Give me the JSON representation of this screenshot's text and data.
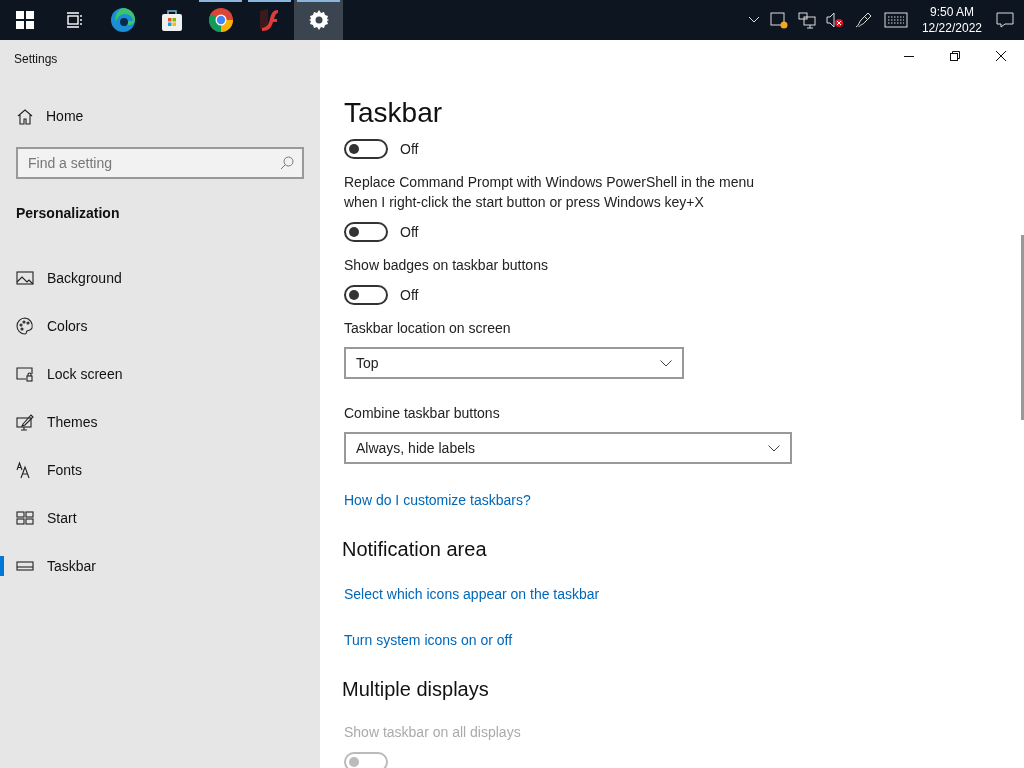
{
  "taskbar": {
    "apps": [
      {
        "kind": "start",
        "running": false,
        "selected": false
      },
      {
        "kind": "taskview",
        "running": false,
        "selected": false
      },
      {
        "kind": "edge",
        "running": false,
        "selected": false
      },
      {
        "kind": "store",
        "running": false,
        "selected": false
      },
      {
        "kind": "chrome",
        "running": true,
        "selected": false
      },
      {
        "kind": "flash",
        "running": true,
        "selected": false
      },
      {
        "kind": "settings",
        "running": true,
        "selected": true
      }
    ],
    "time": "9:50 AM",
    "date": "12/22/2022"
  },
  "window": {
    "title": "Settings"
  },
  "sidebar": {
    "home": "Home",
    "search": {
      "placeholder": "Find a setting"
    },
    "section": "Personalization",
    "items": [
      {
        "kind": "background",
        "label": "Background",
        "selected": false
      },
      {
        "kind": "colors",
        "label": "Colors",
        "selected": false
      },
      {
        "kind": "lock",
        "label": "Lock screen",
        "selected": false
      },
      {
        "kind": "themes",
        "label": "Themes",
        "selected": false
      },
      {
        "kind": "fonts",
        "label": "Fonts",
        "selected": false
      },
      {
        "kind": "start",
        "label": "Start",
        "selected": false
      },
      {
        "kind": "taskbar",
        "label": "Taskbar",
        "selected": true
      }
    ]
  },
  "page": {
    "title": "Taskbar",
    "settings": [
      {
        "kind": "toggle",
        "on": false,
        "state": "Off",
        "disabled": false
      },
      {
        "kind": "toggle",
        "label": "Replace Command Prompt with Windows PowerShell in the menu when I right-click the start button or press Windows key+X",
        "on": false,
        "state": "Off",
        "disabled": false
      },
      {
        "kind": "toggle",
        "label": "Show badges on taskbar buttons",
        "on": false,
        "state": "Off",
        "disabled": false
      },
      {
        "kind": "dropdown",
        "label": "Taskbar location on screen",
        "value": "Top",
        "wide": false
      },
      {
        "kind": "dropdown",
        "label": "Combine taskbar buttons",
        "value": "Always, hide labels",
        "wide": true
      },
      {
        "kind": "link",
        "label": "How do I customize taskbars?"
      },
      {
        "kind": "heading",
        "label": "Notification area"
      },
      {
        "kind": "link",
        "label": "Select which icons appear on the taskbar"
      },
      {
        "kind": "link",
        "label": "Turn system icons on or off"
      },
      {
        "kind": "heading",
        "label": "Multiple displays"
      },
      {
        "kind": "toggle",
        "label": "Show taskbar on all displays",
        "on": false,
        "disabled": true
      }
    ]
  }
}
